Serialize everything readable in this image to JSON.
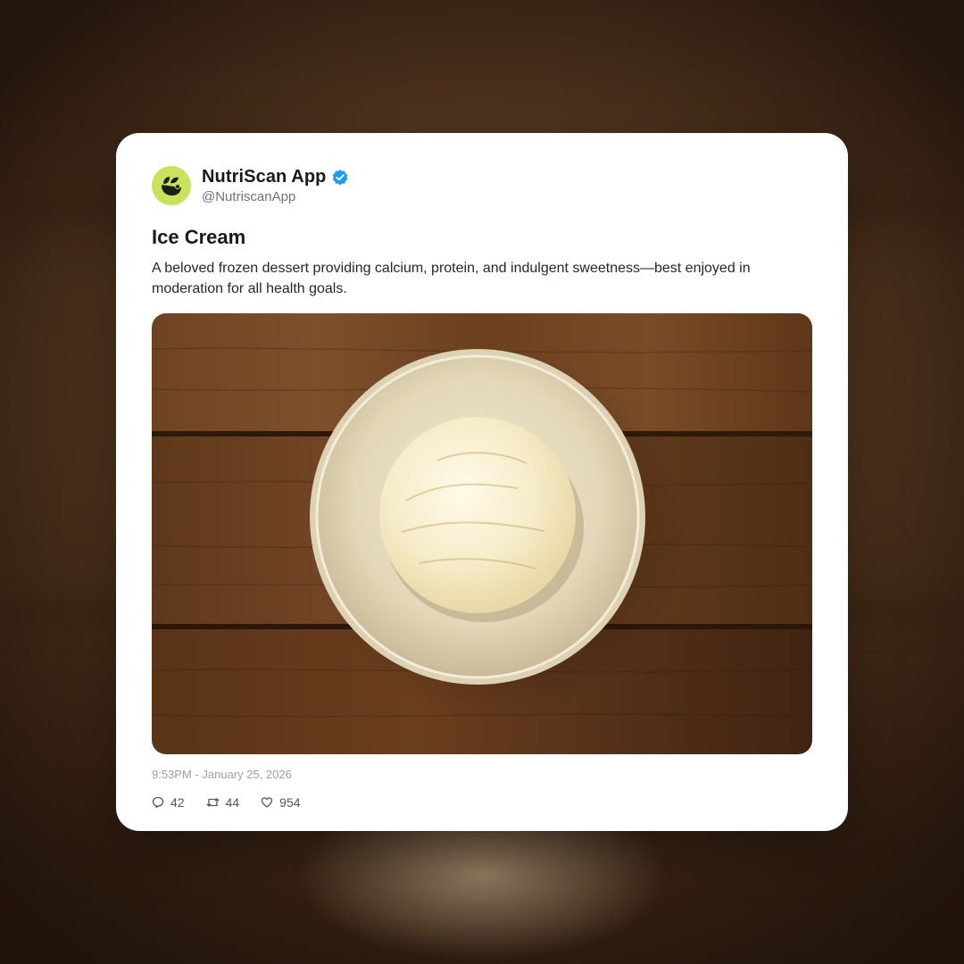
{
  "account": {
    "display_name": "NutriScan App",
    "handle": "@NutriscanApp",
    "verified": true,
    "avatar_icon": "leaf-logo-icon",
    "avatar_color": "#c8e35b",
    "verified_color": "#1d9bf0"
  },
  "post": {
    "title": "Ice Cream",
    "body": "A beloved frozen dessert providing calcium, protein, and indulgent sweetness—best enjoyed in moderation for all health goals.",
    "image_icon": "ice-cream-bowl-photo",
    "timestamp": "9:53PM - January 25, 2026"
  },
  "stats": {
    "replies": "42",
    "reposts": "44",
    "likes": "954",
    "reply_icon": "comment-icon",
    "repost_icon": "repost-icon",
    "like_icon": "heart-icon"
  }
}
